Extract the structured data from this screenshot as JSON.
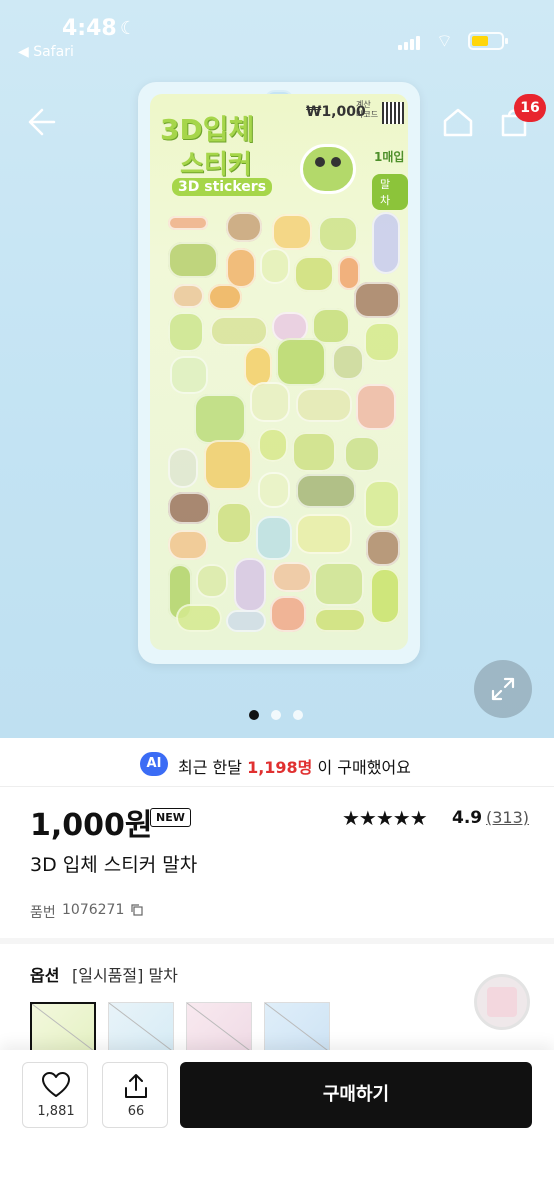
{
  "status_bar": {
    "time": "4:48",
    "back_app": "◀ Safari"
  },
  "nav": {
    "cart_count": "16"
  },
  "product_image": {
    "pack_title_line1": "3D입체",
    "pack_title_line2": "스티커",
    "pack_title_line3": "3D stickers",
    "pack_price": "₩1,000",
    "pack_code_label": "계산 바코드",
    "pack_count": "1매입",
    "pack_flavor": "말 차",
    "carousel_total": 3,
    "carousel_index": 0
  },
  "buyers": {
    "ai_badge": "AI",
    "prefix": "최근 한달 ",
    "count": "1,198명",
    "suffix": " 이 구매했어요"
  },
  "product": {
    "price": "1,000원",
    "new_badge": "NEW",
    "stars": "★★★★★",
    "rating": "4.9",
    "reviews": "(313)",
    "title": "3D 입체 스티커 말차",
    "sku_label": "품번",
    "sku_value": "1076271"
  },
  "option": {
    "label": "옵션",
    "value": "[일시품절] 말차",
    "thumbs": [
      "말차",
      "option-2",
      "option-3",
      "option-4"
    ]
  },
  "actions": {
    "like_count": "1,881",
    "share_count": "66",
    "buy_label": "구매하기"
  },
  "colors": {
    "accent": "#111111",
    "badge_red": "#e8252e",
    "highlight": "#e03030",
    "ai_blue": "#3b6cf5"
  }
}
